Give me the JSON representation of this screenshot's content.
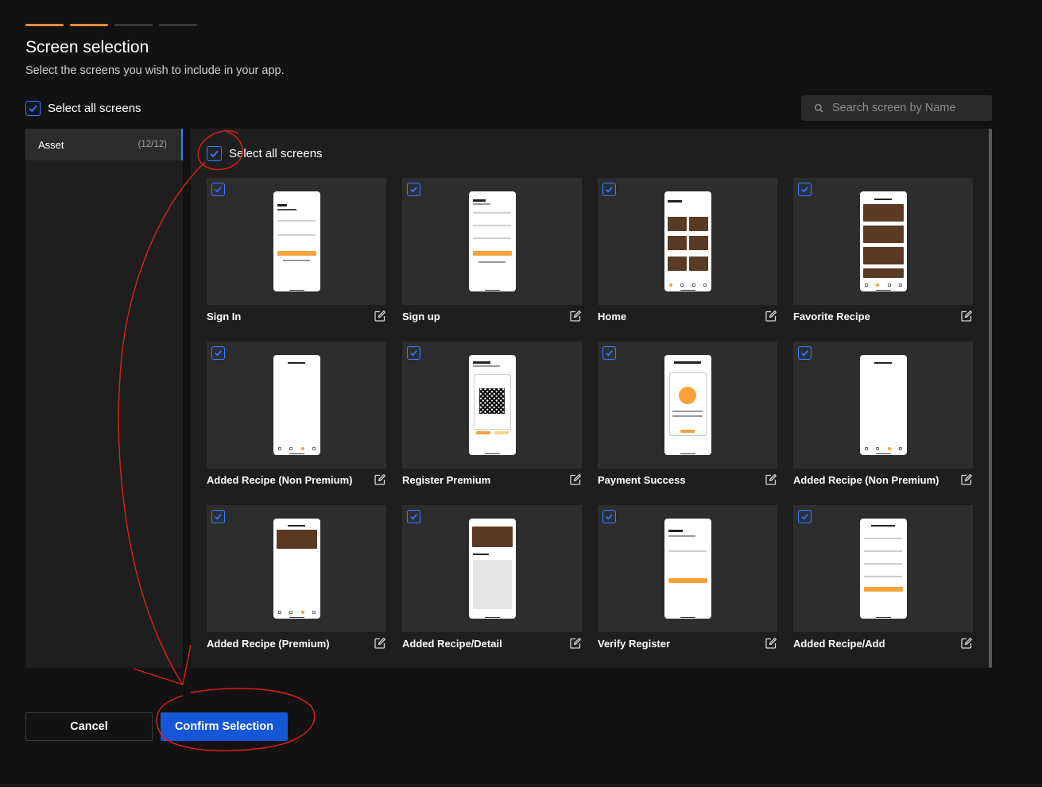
{
  "progress": {
    "steps": 4,
    "completed": 2
  },
  "header": {
    "title": "Screen selection",
    "subtitle": "Select the screens you wish to include in your app."
  },
  "global_select_all": {
    "label": "Select all screens",
    "checked": true
  },
  "search": {
    "placeholder": "Search screen by Name",
    "value": ""
  },
  "sidebar": {
    "items": [
      {
        "label": "Asset",
        "count": "(12/12)",
        "selected": true
      }
    ]
  },
  "main": {
    "select_all": {
      "label": "Select all screens",
      "checked": true
    },
    "screens": [
      {
        "name": "Sign In",
        "checked": true,
        "mock": "signin"
      },
      {
        "name": "Sign up",
        "checked": true,
        "mock": "signup"
      },
      {
        "name": "Home",
        "checked": true,
        "mock": "home"
      },
      {
        "name": "Favorite Recipe",
        "checked": true,
        "mock": "favorite"
      },
      {
        "name": "Added Recipe (Non Premium)",
        "checked": true,
        "mock": "blank-nav"
      },
      {
        "name": "Register Premium",
        "checked": true,
        "mock": "qr"
      },
      {
        "name": "Payment Success",
        "checked": true,
        "mock": "payment"
      },
      {
        "name": "Added Recipe (Non Premium)",
        "checked": true,
        "mock": "blank-nav"
      },
      {
        "name": "Added Recipe (Premium)",
        "checked": true,
        "mock": "premium"
      },
      {
        "name": "Added Recipe/Detail",
        "checked": true,
        "mock": "detail"
      },
      {
        "name": "Verify Register",
        "checked": true,
        "mock": "verify"
      },
      {
        "name": "Added Recipe/Add",
        "checked": true,
        "mock": "add"
      }
    ]
  },
  "footer": {
    "cancel_label": "Cancel",
    "confirm_label": "Confirm Selection"
  },
  "colors": {
    "accent": "#1557d6",
    "checkbox": "#3b7bff",
    "progress_active": "#f08a3a",
    "annotation": "#e0201a"
  }
}
